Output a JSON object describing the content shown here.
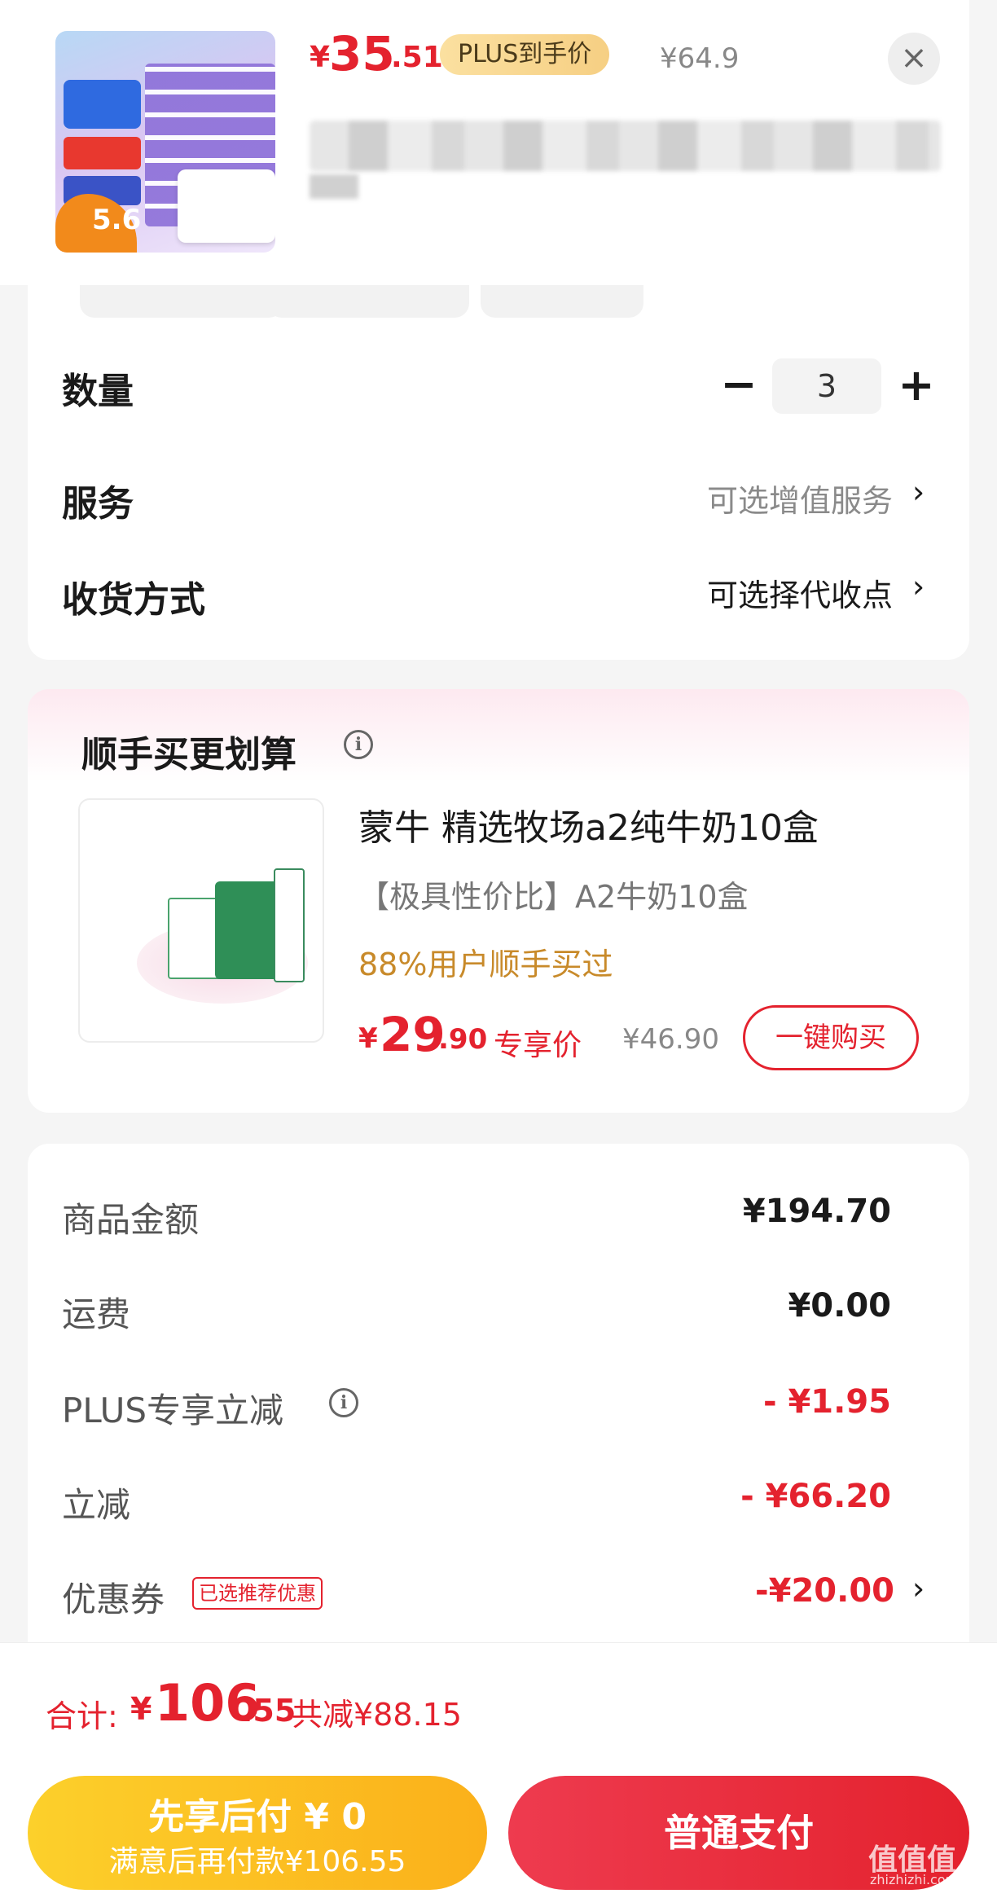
{
  "header": {
    "currency": "¥",
    "price_int": "35",
    "price_dec": ".51",
    "plus_tag": "PLUS到手价",
    "original_price": "¥64.9",
    "close_icon": "×",
    "thumb_discount": "5.6"
  },
  "spec": {
    "quantity_label": "数量",
    "quantity_minus": "−",
    "quantity_value": "3",
    "quantity_plus": "+",
    "service_label": "服务",
    "service_value": "可选增值服务",
    "delivery_label": "收货方式",
    "delivery_value": "可选择代收点",
    "chevron": "›"
  },
  "recommend": {
    "title": "顺手买更划算",
    "info_icon": "i",
    "product_name": "蒙牛 精选牧场a2纯牛奶10盒",
    "product_sub": "【极具性价比】A2牛奶10盒",
    "bought_pct": "88%用户顺手买过",
    "currency": "¥",
    "price_int": "29",
    "price_dec": ".90",
    "price_tag": "专享价",
    "original_price": "¥46.90",
    "buy_button": "一键购买"
  },
  "amounts": {
    "rows": [
      {
        "label": "商品金额",
        "value": "¥194.70"
      },
      {
        "label": "运费",
        "value": "¥0.00"
      },
      {
        "label": "PLUS专享立减",
        "value": "- ¥1.95"
      },
      {
        "label": "立减",
        "value": "- ¥66.20"
      },
      {
        "label": "优惠券",
        "value": "-¥20.00"
      }
    ],
    "coupon_badge": "已选推荐优惠",
    "info_icon": "i",
    "chevron": "›"
  },
  "total": {
    "label": "合计:",
    "currency": "¥",
    "int": "106",
    "dec": ".55",
    "saved": "共减¥88.15"
  },
  "buttons": {
    "pay_later_line1": "先享后付 ¥ 0",
    "pay_later_line2": "满意后再付款¥106.55",
    "pay_normal": "普通支付"
  },
  "watermark": {
    "text": "值值值",
    "url": "zhizhizhi.com"
  },
  "colors": {
    "accent_red": "#e4222e",
    "pay_later_yellow": "#fbb01a",
    "plus_gold": "#f6cf83"
  }
}
